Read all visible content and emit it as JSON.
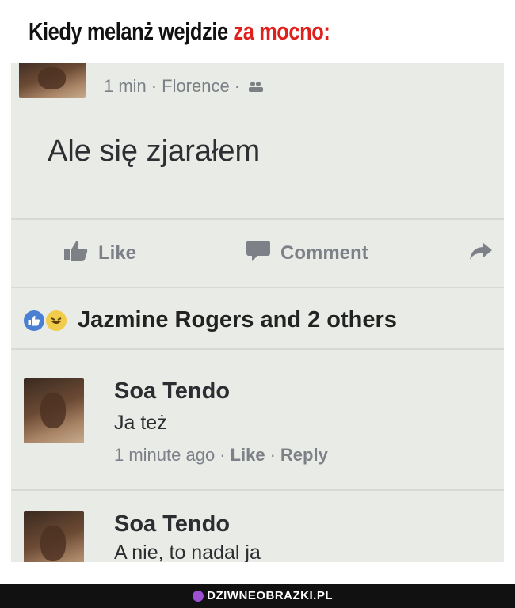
{
  "headline": {
    "part1": "Kiedy melanż wejdzie ",
    "part2": "za mocno:"
  },
  "post": {
    "meta": {
      "time": "1 min",
      "separator": "·",
      "location": "Florence",
      "audience_icon": "group-icon"
    },
    "text": "Ale się zjarałem",
    "actions": {
      "like_label": "Like",
      "comment_label": "Comment",
      "share_icon": "share-arrow-icon"
    }
  },
  "reactions": {
    "icons": [
      "like-reaction-icon",
      "haha-reaction-icon"
    ],
    "names": "Jazmine Rogers and 2 others"
  },
  "comments": [
    {
      "author": "Soa Tendo",
      "text": "Ja też",
      "time": "1 minute ago",
      "separator": "·",
      "like_label": "Like",
      "reply_label": "Reply"
    },
    {
      "author": "Soa Tendo",
      "text": "A nie, to nadal ja"
    }
  ],
  "watermark": "DZIWNEOBRAZKI.PL",
  "colors": {
    "accent_red": "#e0201c",
    "background": "#e9ebe6",
    "like_blue": "#4a7fd3"
  }
}
